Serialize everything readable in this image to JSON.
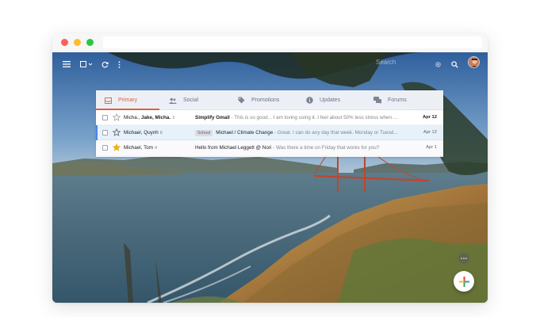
{
  "toolbar": {
    "menu_icon": "hamburger-menu-icon",
    "select_icon": "select-checkbox-icon",
    "refresh_icon": "refresh-icon",
    "more_icon": "more-vertical-icon",
    "settings_icon": "gear-icon",
    "search_icon": "search-icon",
    "search_text": "Search"
  },
  "tabs": [
    {
      "label": "Primary",
      "icon": "inbox-icon",
      "active": true
    },
    {
      "label": "Social",
      "icon": "people-icon",
      "active": false
    },
    {
      "label": "Promotions",
      "icon": "tag-icon",
      "active": false
    },
    {
      "label": "Updates",
      "icon": "info-icon",
      "active": false
    },
    {
      "label": "Forums",
      "icon": "forum-icon",
      "active": false
    }
  ],
  "emails": [
    {
      "sender_prefix": "Micha., ",
      "sender_bold": "Jake, Micha.",
      "count": "3",
      "label": "",
      "subject": "Simplify Gmail",
      "snippet": " - This is so good... I am loving using it. I feel about 50% less stress when ...",
      "date": "Apr 12",
      "starred": false,
      "unread": true
    },
    {
      "sender_prefix": "Michael, Quynh",
      "sender_bold": "",
      "count": "8",
      "label": "School",
      "subject": "Michael / Climate Change",
      "snippet": " - Great. I can do any day that week. Monday or Tuesd...",
      "date": "Apr 12",
      "starred": false,
      "unread": false
    },
    {
      "sender_prefix": "Michael, Tom",
      "sender_bold": "",
      "count": "4",
      "label": "",
      "subject": "Hello from Michael Leggett @ Nori",
      "snippet": " - Was there a time on Friday that works for you?",
      "date": "Apr 1",
      "starred": true,
      "unread": false
    }
  ],
  "colors": {
    "accent": "#d9623c",
    "star": "#f4b400",
    "selected_bar": "#4a86e8"
  },
  "compose": {
    "icon": "plus-icon",
    "more_icon": "more-horizontal-icon"
  }
}
